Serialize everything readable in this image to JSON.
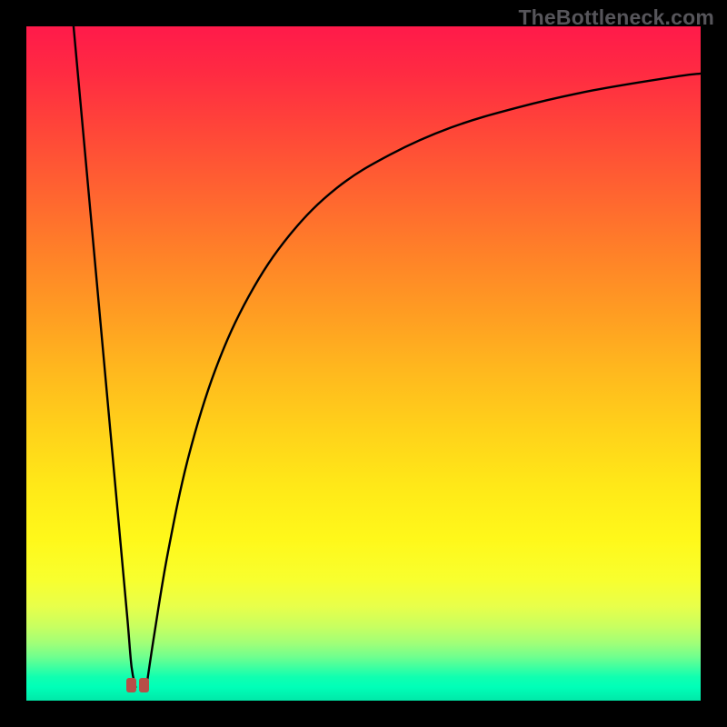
{
  "watermark": "TheBottleneck.com",
  "chart_data": {
    "type": "line",
    "title": "",
    "xlabel": "",
    "ylabel": "",
    "xlim": [
      0,
      100
    ],
    "ylim": [
      0,
      100
    ],
    "grid": false,
    "legend": false,
    "series": [
      {
        "name": "left-branch",
        "x": [
          7,
          8,
          9,
          10,
          11,
          12,
          13,
          14,
          15,
          15.6,
          16.2
        ],
        "y": [
          100,
          89,
          78,
          67,
          56,
          45,
          34,
          23,
          12,
          5,
          2
        ]
      },
      {
        "name": "right-branch",
        "x": [
          17.8,
          19,
          21,
          24,
          28,
          33,
          39,
          46,
          54,
          63,
          73,
          84,
          96,
          100
        ],
        "y": [
          2,
          10,
          22,
          36,
          49,
          60,
          69,
          76,
          81,
          85,
          88,
          90.5,
          92.5,
          93
        ]
      }
    ],
    "markers": [
      {
        "name": "min-marker-left",
        "x": 15.6,
        "y": 2.3
      },
      {
        "name": "min-marker-right",
        "x": 17.5,
        "y": 2.3
      }
    ],
    "gradient_stops": [
      {
        "pos": 0,
        "color": "#ff1a4a"
      },
      {
        "pos": 50,
        "color": "#ffd21a"
      },
      {
        "pos": 85,
        "color": "#f8ff2e"
      },
      {
        "pos": 100,
        "color": "#00e8a8"
      }
    ]
  }
}
